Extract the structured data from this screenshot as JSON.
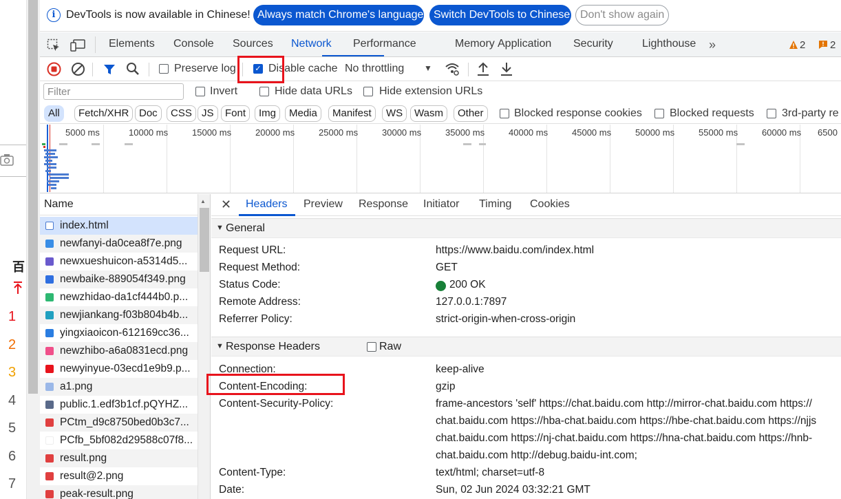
{
  "infobar": {
    "message": "DevTools is now available in Chinese!",
    "match_button": "Always match Chrome's language",
    "switch_button": "Switch DevTools to Chinese",
    "dismiss_button": "Don't show again"
  },
  "left_page": {
    "char": "百",
    "numbers": [
      "1",
      "2",
      "3",
      "4",
      "5",
      "6",
      "7"
    ],
    "number_colors": [
      "#e8131c",
      "#f06c00",
      "#f0a000",
      "#555555",
      "#555555",
      "#555555",
      "#555555"
    ]
  },
  "tabs": [
    "Elements",
    "Console",
    "Sources",
    "Network",
    "Performance",
    "Memory",
    "Application",
    "Security",
    "Lighthouse"
  ],
  "active_tab": "Network",
  "warnings_count": "2",
  "issues_count": "2",
  "toolbar": {
    "preserve_log": "Preserve log",
    "disable_cache": "Disable cache",
    "throttling": "No throttling"
  },
  "filter": {
    "placeholder": "Filter",
    "invert": "Invert",
    "hide_data_urls": "Hide data URLs",
    "hide_extension_urls": "Hide extension URLs"
  },
  "type_filters": [
    "All",
    "Fetch/XHR",
    "Doc",
    "CSS",
    "JS",
    "Font",
    "Img",
    "Media",
    "Manifest",
    "WS",
    "Wasm",
    "Other"
  ],
  "extra_filters": [
    "Blocked response cookies",
    "Blocked requests",
    "3rd-party re"
  ],
  "timeline_ticks": [
    "5000 ms",
    "10000 ms",
    "15000 ms",
    "20000 ms",
    "25000 ms",
    "30000 ms",
    "35000 ms",
    "40000 ms",
    "45000 ms",
    "50000 ms",
    "55000 ms",
    "60000 ms",
    "6500"
  ],
  "request_list": {
    "header": "Name",
    "rows": [
      {
        "name": "index.html",
        "icon_color": "#4a7bd1"
      },
      {
        "name": "newfanyi-da0cea8f7e.png",
        "icon_color": "#3a8ee6"
      },
      {
        "name": "newxueshuicon-a5314d5...",
        "icon_color": "#6a5acd"
      },
      {
        "name": "newbaike-889054f349.png",
        "icon_color": "#2f6fe0"
      },
      {
        "name": "newzhidao-da1cf444b0.p...",
        "icon_color": "#2eb872"
      },
      {
        "name": "newjiankang-f03b804b4b...",
        "icon_color": "#20a0c0"
      },
      {
        "name": "yingxiaoicon-612169cc36...",
        "icon_color": "#2a7de1"
      },
      {
        "name": "newzhibo-a6a0831ecd.png",
        "icon_color": "#f0508a"
      },
      {
        "name": "newyinyue-03ecd1e9b9.p...",
        "icon_color": "#e8131c"
      },
      {
        "name": "a1.png",
        "icon_color": "#9bb8e8"
      },
      {
        "name": "public.1.edf3b1cf.pQYHZ...",
        "icon_color": "#5a6a8a"
      },
      {
        "name": "PCtm_d9c8750bed0b3c7...",
        "icon_color": "#e04040"
      },
      {
        "name": "PCfb_5bf082d29588c07f8...",
        "icon_color": "#ffffff"
      },
      {
        "name": "result.png",
        "icon_color": "#e04040"
      },
      {
        "name": "result@2.png",
        "icon_color": "#e04040"
      },
      {
        "name": "peak-result.png",
        "icon_color": "#e04040"
      }
    ]
  },
  "detail_tabs": [
    "Headers",
    "Preview",
    "Response",
    "Initiator",
    "Timing",
    "Cookies"
  ],
  "active_detail_tab": "Headers",
  "general": {
    "title": "General",
    "rows": [
      {
        "key": "Request URL:",
        "value": "https://www.baidu.com/index.html"
      },
      {
        "key": "Request Method:",
        "value": "GET"
      },
      {
        "key": "Status Code:",
        "value": "200 OK"
      },
      {
        "key": "Remote Address:",
        "value": "127.0.0.1:7897"
      },
      {
        "key": "Referrer Policy:",
        "value": "strict-origin-when-cross-origin"
      }
    ]
  },
  "response_headers": {
    "title": "Response Headers",
    "raw_label": "Raw",
    "rows": [
      {
        "key": "Connection:",
        "value": "keep-alive"
      },
      {
        "key": "Content-Encoding:",
        "value": "gzip"
      },
      {
        "key": "Content-Security-Policy:",
        "value": "frame-ancestors 'self' https://chat.baidu.com http://mirror-chat.baidu.com https://"
      },
      {
        "key": "",
        "value": "chat.baidu.com https://hba-chat.baidu.com https://hbe-chat.baidu.com https://njjs"
      },
      {
        "key": "",
        "value": "chat.baidu.com https://nj-chat.baidu.com https://hna-chat.baidu.com https://hnb-"
      },
      {
        "key": "",
        "value": "chat.baidu.com http://debug.baidu-int.com;"
      },
      {
        "key": "Content-Type:",
        "value": "text/html; charset=utf-8"
      },
      {
        "key": "Date:",
        "value": "Sun, 02 Jun 2024 03:32:21 GMT"
      }
    ]
  },
  "colors": {
    "accent": "#0b57d0",
    "highlight": "#e8131c",
    "status_ok": "#188038",
    "warning": "#e37400"
  }
}
